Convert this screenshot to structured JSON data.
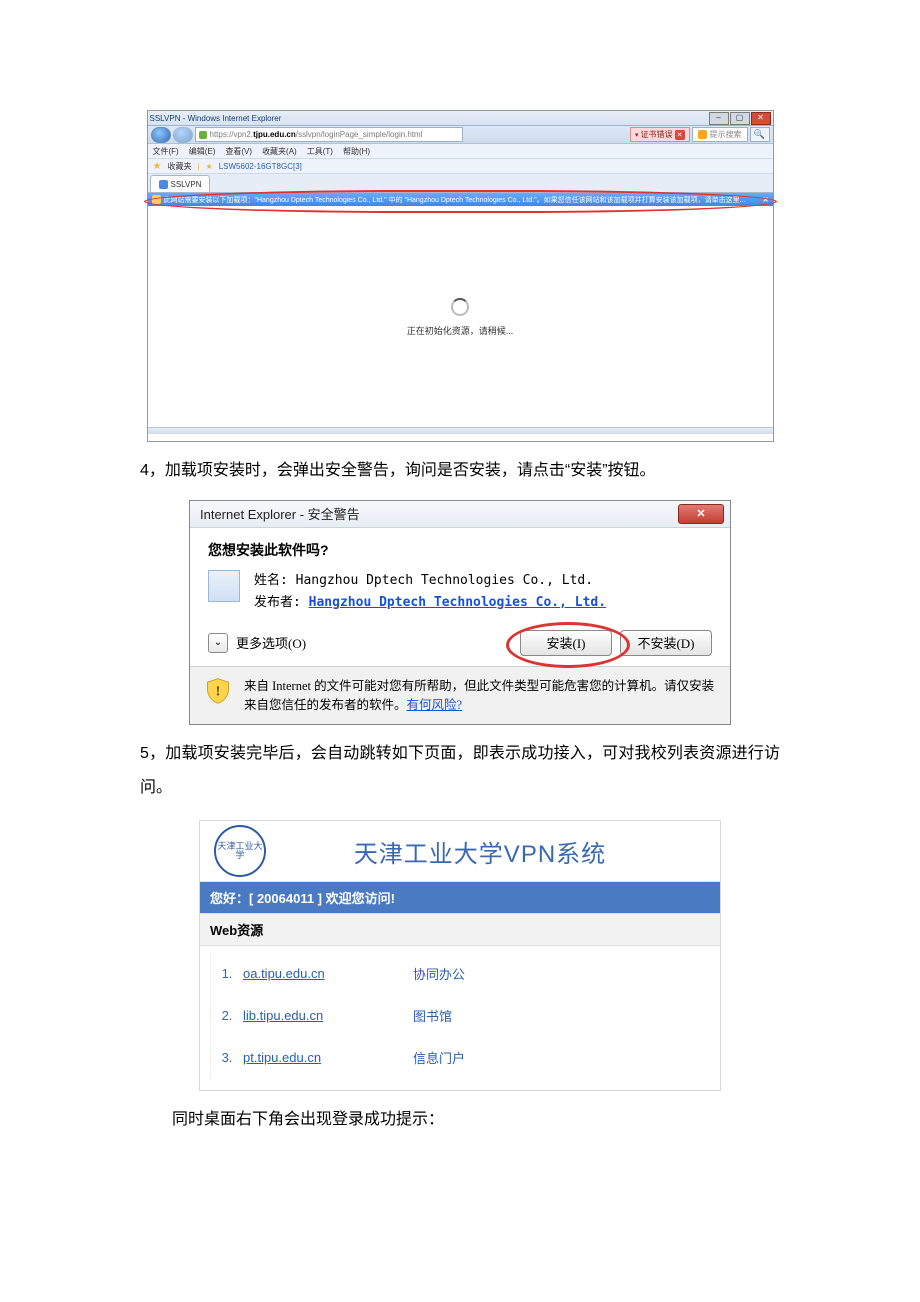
{
  "ie": {
    "window_title": "SSLVPN - Windows Internet Explorer",
    "win_min": "–",
    "win_max": "▢",
    "win_close": "✕",
    "url_bold": "tjpu.edu.cn",
    "url_prefix": "https://vpn2.",
    "url_suffix": "/sslvpn/loginPage_simple/login.html",
    "cert_error": "证书错误",
    "cert_x": "✕",
    "bing_placeholder": "提示搜索",
    "magnifier": "🔍",
    "menu": [
      "文件(F)",
      "编辑(E)",
      "查看(V)",
      "收藏夹(A)",
      "工具(T)",
      "帮助(H)"
    ],
    "fav_label": "收藏夹",
    "fav_item": "LSW5602-16GT8GC[3]",
    "tab_label": "SSLVPN",
    "info_bar": "此网站需要安装以下加载项：\"Hangzhou Dptech Technologies Co., Ltd.\" 中的 \"Hangzhou Dptech Technologies Co., Ltd.\"。如果您信任该网站和该加载项并打算安装该加载项，请单击这里...",
    "info_x": "✕",
    "loading": "正在初始化资源，请稍候..."
  },
  "para4": "4，加载项安装时，会弹出安全警告，询问是否安装，请点击“安装”按钮。",
  "sec": {
    "title": "Internet Explorer - 安全警告",
    "close": "✕",
    "question": "您想安装此软件吗?",
    "name_label": "姓名:",
    "name_value": "Hangzhou Dptech Technologies Co., Ltd.",
    "pub_label": "发布者:",
    "pub_value": "Hangzhou Dptech Technologies Co., Ltd.",
    "more_caret": "⌄",
    "more": "更多选项(O)",
    "install": "安装(I)",
    "dont": "不安装(D)",
    "warn": "来自 Internet 的文件可能对您有所帮助，但此文件类型可能危害您的计算机。请仅安装来自您信任的发布者的软件。",
    "risk": "有何风险?"
  },
  "para5": "5，加载项安装完毕后，会自动跳转如下页面，即表示成功接入，可对我校列表资源进行访问。",
  "vpn": {
    "logo_text": "天津工业大学",
    "title": "天津工业大学VPN系统",
    "welcome": "您好：[ 20064011 ] 欢迎您访问!",
    "section": "Web资源",
    "items": [
      {
        "n": "1.",
        "url": "oa.tipu.edu.cn",
        "desc": "协同办公"
      },
      {
        "n": "2.",
        "url": "lib.tipu.edu.cn",
        "desc": "图书馆"
      },
      {
        "n": "3.",
        "url": "pt.tipu.edu.cn",
        "desc": "信息门户"
      }
    ]
  },
  "foot": "同时桌面右下角会出现登录成功提示："
}
